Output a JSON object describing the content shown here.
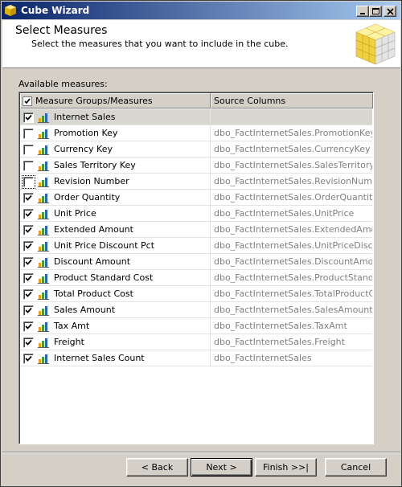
{
  "window": {
    "title": "Cube Wizard"
  },
  "header": {
    "title": "Select Measures",
    "subtitle": "Select the measures that you want to include in the cube."
  },
  "available_label": "Available measures:",
  "columns": {
    "name": "Measure Groups/Measures",
    "source": "Source Columns"
  },
  "rows": [
    {
      "name": "Internet Sales",
      "source": "",
      "checked": true,
      "group": true
    },
    {
      "name": "Promotion Key",
      "source": "dbo_FactInternetSales.PromotionKey",
      "checked": false
    },
    {
      "name": "Currency Key",
      "source": "dbo_FactInternetSales.CurrencyKey",
      "checked": false
    },
    {
      "name": "Sales Territory Key",
      "source": "dbo_FactInternetSales.SalesTerritory...",
      "checked": false
    },
    {
      "name": "Revision Number",
      "source": "dbo_FactInternetSales.RevisionNumber",
      "checked": false
    },
    {
      "name": "Order Quantity",
      "source": "dbo_FactInternetSales.OrderQuantity",
      "checked": true
    },
    {
      "name": "Unit Price",
      "source": "dbo_FactInternetSales.UnitPrice",
      "checked": true
    },
    {
      "name": "Extended Amount",
      "source": "dbo_FactInternetSales.ExtendedAmo...",
      "checked": true
    },
    {
      "name": "Unit Price Discount Pct",
      "source": "dbo_FactInternetSales.UnitPriceDisco...",
      "checked": true
    },
    {
      "name": "Discount Amount",
      "source": "dbo_FactInternetSales.DiscountAmount",
      "checked": true
    },
    {
      "name": "Product Standard Cost",
      "source": "dbo_FactInternetSales.ProductStand...",
      "checked": true
    },
    {
      "name": "Total Product Cost",
      "source": "dbo_FactInternetSales.TotalProductC...",
      "checked": true
    },
    {
      "name": "Sales Amount",
      "source": "dbo_FactInternetSales.SalesAmount",
      "checked": true
    },
    {
      "name": "Tax Amt",
      "source": "dbo_FactInternetSales.TaxAmt",
      "checked": true
    },
    {
      "name": "Freight",
      "source": "dbo_FactInternetSales.Freight",
      "checked": true
    },
    {
      "name": "Internet Sales Count",
      "source": "dbo_FactInternetSales",
      "checked": true
    }
  ],
  "buttons": {
    "back": "< Back",
    "next": "Next >",
    "finish": "Finish >>|",
    "cancel": "Cancel"
  },
  "icons": {
    "window": "cube-icon",
    "header": "cube-logo-icon",
    "measure": "bar-chart-icon"
  },
  "colors": {
    "titlebar_start": "#0a246a",
    "titlebar_end": "#a6caf0",
    "face": "#d4d0c8",
    "source_text": "#808080"
  }
}
